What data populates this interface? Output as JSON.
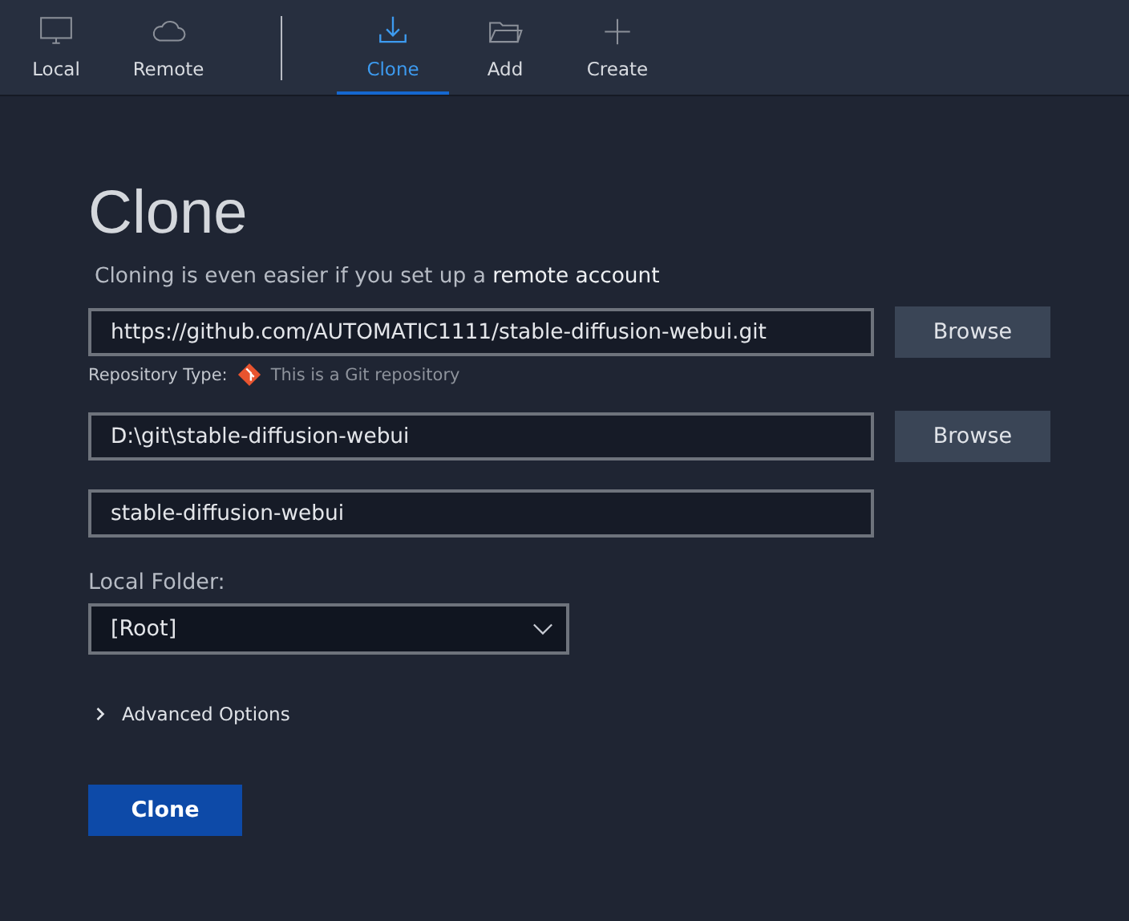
{
  "toolbar": {
    "groups": [
      [
        {
          "label": "Local",
          "selected": false
        },
        {
          "label": "Remote",
          "selected": false
        }
      ],
      [
        {
          "label": "Clone",
          "selected": true
        },
        {
          "label": "Add",
          "selected": false
        },
        {
          "label": "Create",
          "selected": false
        }
      ]
    ]
  },
  "title": "Clone",
  "subtitle": {
    "text": "Cloning is even easier if you set up a ",
    "link": "remote account"
  },
  "source": {
    "value": "https://github.com/AUTOMATIC1111/stable-diffusion-webui.git",
    "button": "Browse",
    "type_label": "Repository Type:",
    "type_text": "This is a Git repository"
  },
  "destination": {
    "value": "D:\\git\\stable-diffusion-webui",
    "button": "Browse"
  },
  "name": {
    "value": "stable-diffusion-webui"
  },
  "local_folder": {
    "label": "Local Folder:",
    "value": "[Root]"
  },
  "advanced": {
    "label": "Advanced Options",
    "expanded": false
  },
  "submit": "Clone"
}
